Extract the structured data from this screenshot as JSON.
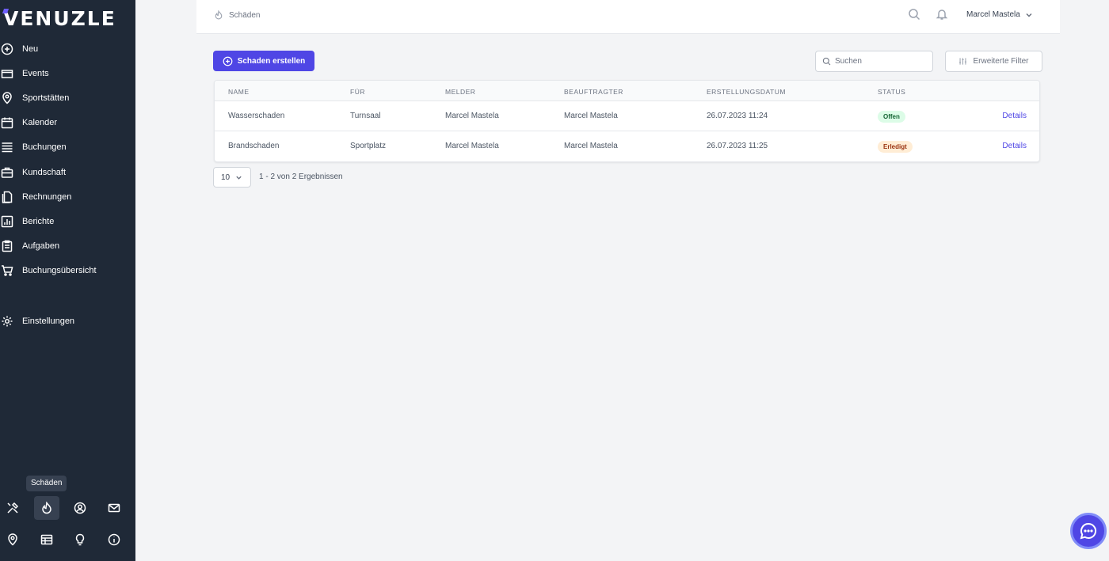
{
  "app": {
    "logo": "VENUZLE"
  },
  "sidebar": {
    "items": [
      {
        "label": "Neu",
        "icon": "plus-circle-icon"
      },
      {
        "label": "Events",
        "icon": "folder-icon"
      },
      {
        "label": "Sportstätten",
        "icon": "map-pin-icon"
      },
      {
        "label": "Kalender",
        "icon": "calendar-icon"
      },
      {
        "label": "Buchungen",
        "icon": "list-icon"
      },
      {
        "label": "Kundschaft",
        "icon": "briefcase-icon"
      },
      {
        "label": "Rechnungen",
        "icon": "documents-icon"
      },
      {
        "label": "Berichte",
        "icon": "chart-icon"
      },
      {
        "label": "Aufgaben",
        "icon": "clipboard-icon"
      },
      {
        "label": "Buchungsübersicht",
        "icon": "cart-icon"
      }
    ],
    "settings": {
      "label": "Einstellungen",
      "icon": "gear-icon"
    },
    "tooltip": "Schäden",
    "quick_icons_row1": [
      "tools-icon",
      "damage-icon",
      "user-circle-icon",
      "mail-icon"
    ],
    "quick_icons_row2": [
      "map-pin-icon",
      "table-icon",
      "lightbulb-icon",
      "info-icon"
    ]
  },
  "header": {
    "breadcrumb": "Schäden",
    "user_name": "Marcel Mastela"
  },
  "toolbar": {
    "create_label": "Schaden erstellen",
    "search_placeholder": "Suchen",
    "filter_label": "Erweiterte Filter"
  },
  "table": {
    "columns": [
      "Name",
      "Für",
      "Melder",
      "Beauftragter",
      "Erstellungsdatum",
      "Status"
    ],
    "rows": [
      {
        "name": "Wasserschaden",
        "fuer": "Turnsaal",
        "melder": "Marcel Mastela",
        "beauftragter": "Marcel Mastela",
        "datum": "26.07.2023 11:24",
        "status": "Offen",
        "action": "Details"
      },
      {
        "name": "Brandschaden",
        "fuer": "Sportplatz",
        "melder": "Marcel Mastela",
        "beauftragter": "Marcel Mastela",
        "datum": "26.07.2023 11:25",
        "status": "Erledigt",
        "action": "Details"
      }
    ]
  },
  "pagination": {
    "page_size": "10",
    "info": "1 - 2 von 2 Ergebnissen"
  },
  "colors": {
    "primary": "#4f46e5",
    "sidebar": "#1f2937",
    "status_open": "#dcfce7",
    "status_done": "#ffedd5"
  }
}
